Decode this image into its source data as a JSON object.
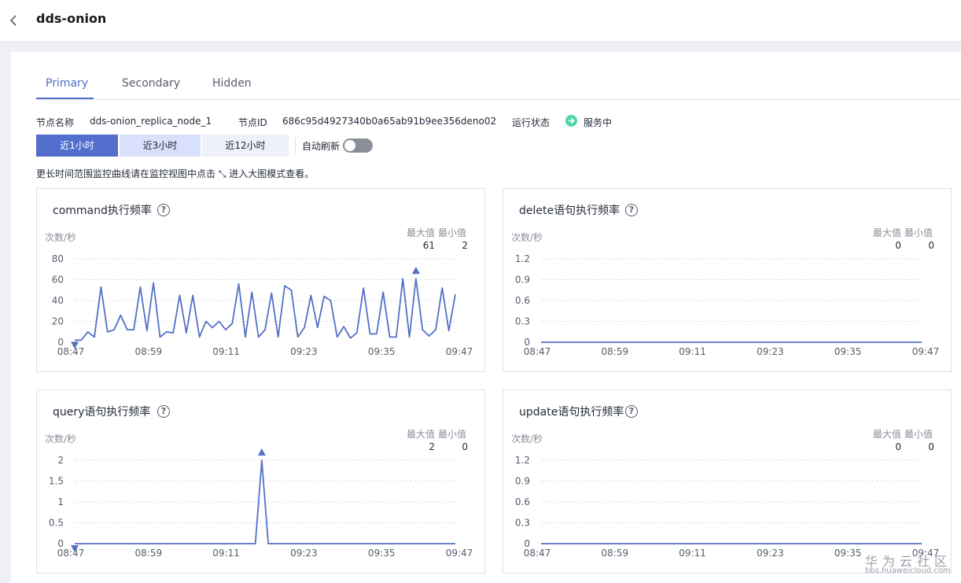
{
  "header": {
    "title": "dds-onion"
  },
  "tabs": [
    {
      "label": "Primary",
      "active": true
    },
    {
      "label": "Secondary",
      "active": false
    },
    {
      "label": "Hidden",
      "active": false
    }
  ],
  "node": {
    "name_label": "节点名称",
    "name_value": "dds-onion_replica_node_1",
    "id_label": "节点ID",
    "id_value": "686c95d4927340b0a65ab91b9ee356deno02",
    "status_label": "运行状态",
    "status_value": "服务中"
  },
  "time_range": {
    "options": [
      "近1小时",
      "近3小时",
      "近12小时"
    ],
    "selected": "近1小时"
  },
  "auto_refresh": {
    "label": "自动刷新",
    "enabled": false
  },
  "hint": "更长时间范围监控曲线请在监控视图中点击 ⤡ 进入大图模式查看。",
  "colors": {
    "accent": "#526ecc",
    "status": "#50d4ab",
    "line": "#5470c6"
  },
  "max_label": "最大值",
  "min_label": "最小值",
  "unit_label": "次数/秒",
  "watermark": {
    "brand": "华为云社区",
    "url": "bbs.huaweicloud.com"
  },
  "chart_data": [
    {
      "type": "line",
      "title": "command执行频率",
      "ylabel": "次数/秒",
      "ylim": [
        0,
        80
      ],
      "yticks": [
        "80",
        "60",
        "40",
        "20",
        "0"
      ],
      "xticks": [
        "08:47",
        "08:59",
        "09:11",
        "09:23",
        "09:35",
        "09:47"
      ],
      "max": "61",
      "min": "2",
      "values": [
        2,
        2,
        10,
        5,
        53,
        10,
        12,
        26,
        12,
        12,
        53,
        11,
        57,
        5,
        10,
        9,
        45,
        9,
        45,
        5,
        20,
        14,
        20,
        12,
        18,
        56,
        5,
        48,
        5,
        12,
        47,
        5,
        54,
        50,
        5,
        14,
        45,
        14,
        44,
        40,
        5,
        15,
        4,
        9,
        52,
        8,
        8,
        48,
        5,
        5,
        61,
        5,
        61,
        12,
        6,
        12,
        52,
        11,
        46
      ],
      "max_marker_index": 52,
      "min_marker_index": 0
    },
    {
      "type": "line",
      "title": "delete语句执行频率",
      "ylabel": "次数/秒",
      "ylim": [
        0,
        1.2
      ],
      "yticks": [
        "1.2",
        "0.9",
        "0.6",
        "0.3",
        "0"
      ],
      "xticks": [
        "08:47",
        "08:59",
        "09:11",
        "09:23",
        "09:35",
        "09:47"
      ],
      "max": "0",
      "min": "0",
      "values": [
        0,
        0
      ],
      "max_marker_index": -1,
      "min_marker_index": -1
    },
    {
      "type": "line",
      "title": "query语句执行频率",
      "ylabel": "次数/秒",
      "ylim": [
        0,
        2
      ],
      "yticks": [
        "2",
        "1.5",
        "1",
        "0.5",
        "0"
      ],
      "xticks": [
        "08:47",
        "08:59",
        "09:11",
        "09:23",
        "09:35",
        "09:47"
      ],
      "max": "2",
      "min": "0",
      "values": [
        0,
        0,
        0,
        0,
        0,
        0,
        0,
        0,
        0,
        0,
        0,
        0,
        0,
        0,
        0,
        0,
        0,
        0,
        0,
        0,
        0,
        0,
        0,
        0,
        0,
        0,
        0,
        0,
        0,
        2,
        0,
        0,
        0,
        0,
        0,
        0,
        0,
        0,
        0,
        0,
        0,
        0,
        0,
        0,
        0,
        0,
        0,
        0,
        0,
        0,
        0,
        0,
        0,
        0,
        0,
        0,
        0,
        0,
        0,
        0
      ],
      "max_marker_index": 29,
      "min_marker_index": 0
    },
    {
      "type": "line",
      "title": "update语句执行频率",
      "ylabel": "次数/秒",
      "ylim": [
        0,
        1.2
      ],
      "yticks": [
        "1.2",
        "0.9",
        "0.6",
        "0.3",
        "0"
      ],
      "xticks": [
        "08:47",
        "08:59",
        "09:11",
        "09:23",
        "09:35",
        "09:47"
      ],
      "max": "0",
      "min": "0",
      "values": [
        0,
        0
      ],
      "max_marker_index": -1,
      "min_marker_index": -1
    }
  ]
}
